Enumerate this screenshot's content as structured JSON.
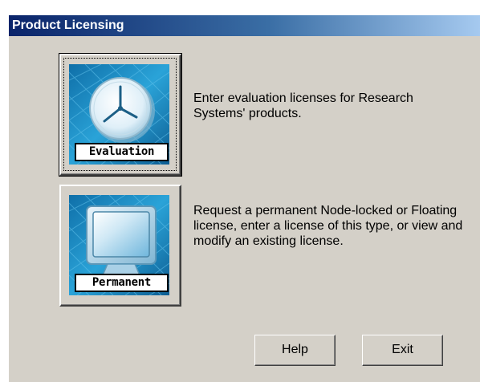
{
  "window": {
    "title": "Product Licensing"
  },
  "options": [
    {
      "button_label": "Evaluation",
      "icon": "clock-icon",
      "description": "Enter evaluation licenses for Research Systems' products."
    },
    {
      "button_label": "Permanent",
      "icon": "monitor-icon",
      "description": "Request a permanent Node-locked or Floating license, enter a license of this type, or view and modify an existing license."
    }
  ],
  "footer": {
    "help_label": "Help",
    "exit_label": "Exit"
  },
  "colors": {
    "dialog_face": "#d4d0c8",
    "title_gradient_start": "#0a246a",
    "title_gradient_end": "#a6caf0",
    "art_blue": "#1a8fc8"
  }
}
